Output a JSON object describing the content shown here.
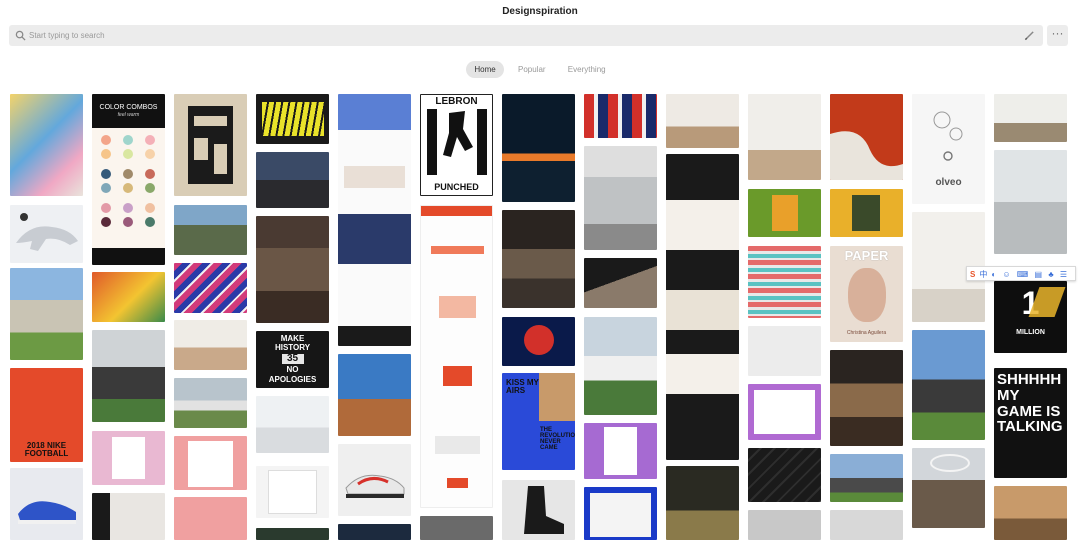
{
  "app": {
    "title": "Designspiration"
  },
  "search": {
    "placeholder": "Start typing to search"
  },
  "menu": {
    "more_label": "···"
  },
  "tabs": [
    {
      "label": "Home",
      "active": true
    },
    {
      "label": "Popular",
      "active": false
    },
    {
      "label": "Everything",
      "active": false
    }
  ],
  "icons": [
    "search-icon",
    "pen-icon",
    "more-icon"
  ],
  "ime": {
    "logo": "S",
    "lang": "中"
  },
  "tiles": {
    "color_combos": {
      "title": "COLOR COMBOS",
      "subtitle": "feel warm"
    },
    "nike_football": {
      "text": "2018 NIKE FOOTBALL"
    },
    "lebron": {
      "top": "LEBRON",
      "bottom": "PUNCHED"
    },
    "make_history": {
      "line1": "MAKE",
      "line2": "HISTORY",
      "line3": "35",
      "line4": "NO",
      "line5": "APOLOGIES"
    },
    "kiss_my_airs": {
      "text": "KISS MY AIRS",
      "sub": "THE REVOLUTION NEVER CAME"
    },
    "paper": {
      "title": "PAPER",
      "sub": "Christina Aguilera"
    },
    "one_million": {
      "number": "1",
      "label": "MILLION"
    },
    "shhhhh": {
      "text": "SHHHHH MY GAME IS TALKING"
    },
    "olive": {
      "text": "olveo"
    }
  }
}
